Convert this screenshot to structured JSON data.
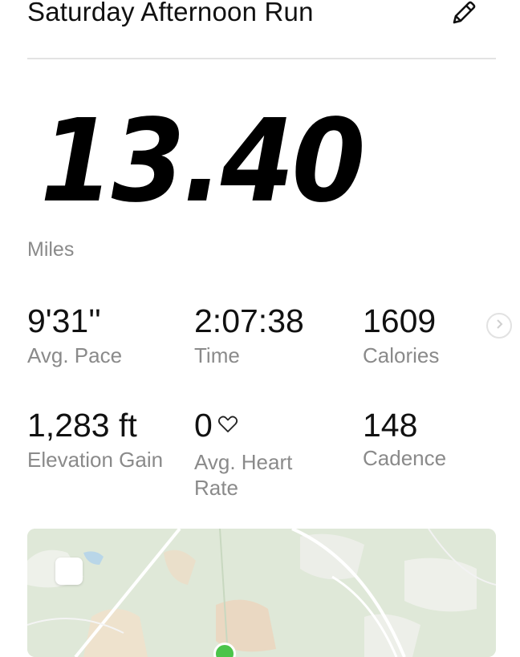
{
  "header": {
    "title": "Saturday Afternoon Run",
    "edit_icon": "pencil-icon"
  },
  "summary": {
    "distance": "13.40",
    "distance_unit": "Miles"
  },
  "stats": [
    {
      "value": "9'31''",
      "label": "Avg. Pace"
    },
    {
      "value": "2:07:38",
      "label": "Time"
    },
    {
      "value": "1609",
      "label": "Calories"
    },
    {
      "value": "1,283 ft",
      "label": "Elevation Gain"
    },
    {
      "value": "0",
      "label": "Avg. Heart Rate",
      "icon": "heart-outline-icon"
    },
    {
      "value": "148",
      "label": "Cadence"
    }
  ],
  "nav": {
    "next_icon": "chevron-right-icon"
  },
  "map": {
    "start_marker_color": "#4bc44a"
  }
}
